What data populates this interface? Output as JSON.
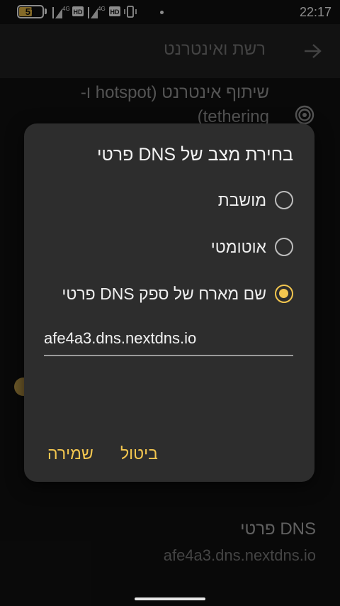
{
  "status_bar": {
    "battery": "57",
    "net1": "4G",
    "hd1": "HD",
    "net2": "4G",
    "hd2": "HD",
    "time": "22:17"
  },
  "app_bar": {
    "title": "רשת ואינטרנט",
    "back_icon": "arrow-back-icon"
  },
  "background": {
    "hotspot_label": "שיתוף אינטרנט (hotspot ו-tethering)",
    "hotspot_icon": "hotspot-icon",
    "private_dns_title": "DNS פרטי",
    "private_dns_value": "afe4a3.dns.nextdns.io"
  },
  "dialog": {
    "title": "בחירת מצב של DNS פרטי",
    "options": [
      {
        "label": "מושבת",
        "checked": false
      },
      {
        "label": "אוטומטי",
        "checked": false
      },
      {
        "label": "שם מארח של ספק DNS פרטי",
        "checked": true
      }
    ],
    "hostname_value": "afe4a3.dns.nextdns.io",
    "cancel_label": "ביטול",
    "save_label": "שמירה"
  },
  "colors": {
    "accent": "#f3c64f",
    "dialog_bg": "#2d2d2d",
    "app_bar_bg": "#212121",
    "page_bg": "#121212"
  }
}
